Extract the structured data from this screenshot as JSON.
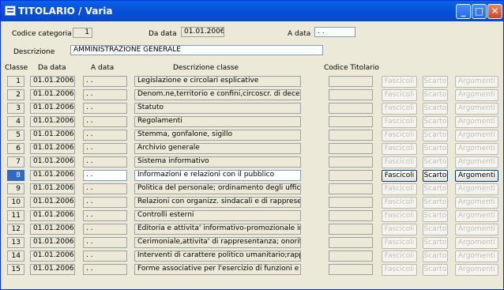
{
  "window": {
    "title": "TITOLARIO / Varia"
  },
  "header": {
    "codice_label": "Codice categoria",
    "codice_value": "1",
    "da_data_label": "Da data",
    "da_data_value": "01.01.2006",
    "a_data_label": "A data",
    "a_data_value": " .  .",
    "descrizione_label": "Descrizione",
    "descrizione_value": "AMMINISTRAZIONE GENERALE"
  },
  "columns": {
    "classe": "Classe",
    "da_data": "Da data",
    "a_data": "A data",
    "descrizione": "Descrizione classe",
    "codice_titolario": "Codice Titolario"
  },
  "buttons": {
    "fascicoli": "Fascicoli",
    "scarto": "Scarto",
    "argomenti": "Argomenti"
  },
  "selected_row": 8,
  "rows": [
    {
      "num": "1",
      "da": "01.01.2006",
      "a": " .  .",
      "desc": "Legislazione e circolari esplicative"
    },
    {
      "num": "2",
      "da": "01.01.2006",
      "a": " .  .",
      "desc": "Denom.ne,territorio e confini,circoscr. di decen"
    },
    {
      "num": "3",
      "da": "01.01.2006",
      "a": " .  .",
      "desc": "Statuto"
    },
    {
      "num": "4",
      "da": "01.01.2006",
      "a": " .  .",
      "desc": "Regolamenti"
    },
    {
      "num": "5",
      "da": "01.01.2006",
      "a": " .  .",
      "desc": "Stemma, gonfalone, sigillo"
    },
    {
      "num": "6",
      "da": "01.01.2006",
      "a": " .  .",
      "desc": "Archivio generale"
    },
    {
      "num": "7",
      "da": "01.01.2006",
      "a": " .  .",
      "desc": "Sistema informativo"
    },
    {
      "num": "8",
      "da": "01.01.2006",
      "a": " .  .",
      "desc": "Informazioni e relazioni con il pubblico"
    },
    {
      "num": "9",
      "da": "01.01.2006",
      "a": " .  .",
      "desc": "Politica del personale; ordinamento degli uffici"
    },
    {
      "num": "10",
      "da": "01.01.2006",
      "a": " .  .",
      "desc": "Relazioni con organizz. sindacali e di rappresen"
    },
    {
      "num": "11",
      "da": "01.01.2006",
      "a": " .  .",
      "desc": "Controlli esterni"
    },
    {
      "num": "12",
      "da": "01.01.2006",
      "a": " .  .",
      "desc": "Editoria e attivita' informativo-promozionale in"
    },
    {
      "num": "13",
      "da": "01.01.2006",
      "a": " .  .",
      "desc": "Cerimoniale,attivita' di rappresentanza; onorifi"
    },
    {
      "num": "14",
      "da": "01.01.2006",
      "a": " .  .",
      "desc": "Interventi di carattere politico umanitario;rapp"
    },
    {
      "num": "15",
      "da": "01.01.2006",
      "a": " .  .",
      "desc": "Forme associative per l'esercizio di funzioni e"
    }
  ]
}
